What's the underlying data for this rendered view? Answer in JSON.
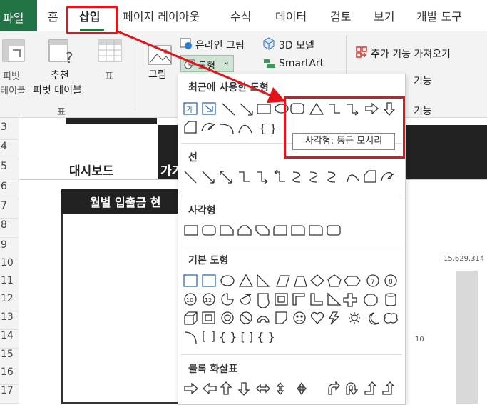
{
  "ribbon_tabs": [
    "파일",
    "홈",
    "삽입",
    "페이지 레이아웃",
    "수식",
    "데이터",
    "검토",
    "보기",
    "개발 도구"
  ],
  "ribbon": {
    "pivot_label_1": "피벗",
    "pivot_label_2": "테이블",
    "recommended_label_1": "추천",
    "recommended_label_2": "피벗 테이블",
    "table_label": "표",
    "group_table": "표",
    "picture_label": "그림",
    "online_picture": "온라인 그림",
    "shapes_button": "도형",
    "model_3d": "3D 모델",
    "smartart": "SmartArt",
    "addins": "추가 기능 가져오기",
    "partial_1": "기능",
    "partial_2": "기능"
  },
  "sheet": {
    "row_numbers": [
      "3",
      "4",
      "5",
      "6",
      "7",
      "8",
      "9",
      "10",
      "11",
      "12",
      "13",
      "14",
      "15",
      "16",
      "17"
    ],
    "dashboard_label": "대시보드",
    "cut_label": "가기",
    "chart_title": "월별 입출금 현",
    "big_number": "15,629,314",
    "small_tick": "10"
  },
  "dropdown": {
    "recent_title": "최근에 사용한 도형",
    "lines_title": "선",
    "rect_title": "사각형",
    "basic_title": "기본 도형",
    "block_title": "블록 화살표",
    "tooltip": "사각형: 둥근 모서리",
    "brace_text": "{  }",
    "basic_row4_braces": "{ }  [  ]  {  }"
  },
  "colors": {
    "excel_green": "#217346",
    "highlight_red": "#e2151b",
    "dashboard_black": "#222222"
  }
}
